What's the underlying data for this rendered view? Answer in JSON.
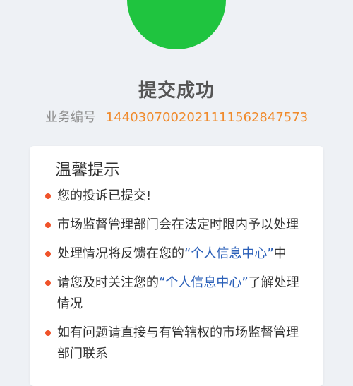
{
  "colors": {
    "success": "#1fc43f",
    "accent_orange": "#f08a2b",
    "link_blue": "#2a5fb8",
    "bullet_red": "#f0532a"
  },
  "icon": "check-circle-icon",
  "title": "提交成功",
  "business": {
    "label": "业务编号",
    "number": "144030700202111156284757​3"
  },
  "notice": {
    "title": "温馨提示",
    "items": [
      {
        "text": "您的投诉已提交!"
      },
      {
        "text": "市场监督管理部门会在法定时限内予以处理"
      },
      {
        "before": "处理情况将反馈在您的",
        "link": "“个人信息中心”",
        "after": "中"
      },
      {
        "before": "请您及时关注您的",
        "link": "“个人信息中心”",
        "after": "了解处理情况"
      },
      {
        "text": "如有问题请直接与有管辖权的市场监督管理部门联系"
      }
    ]
  }
}
